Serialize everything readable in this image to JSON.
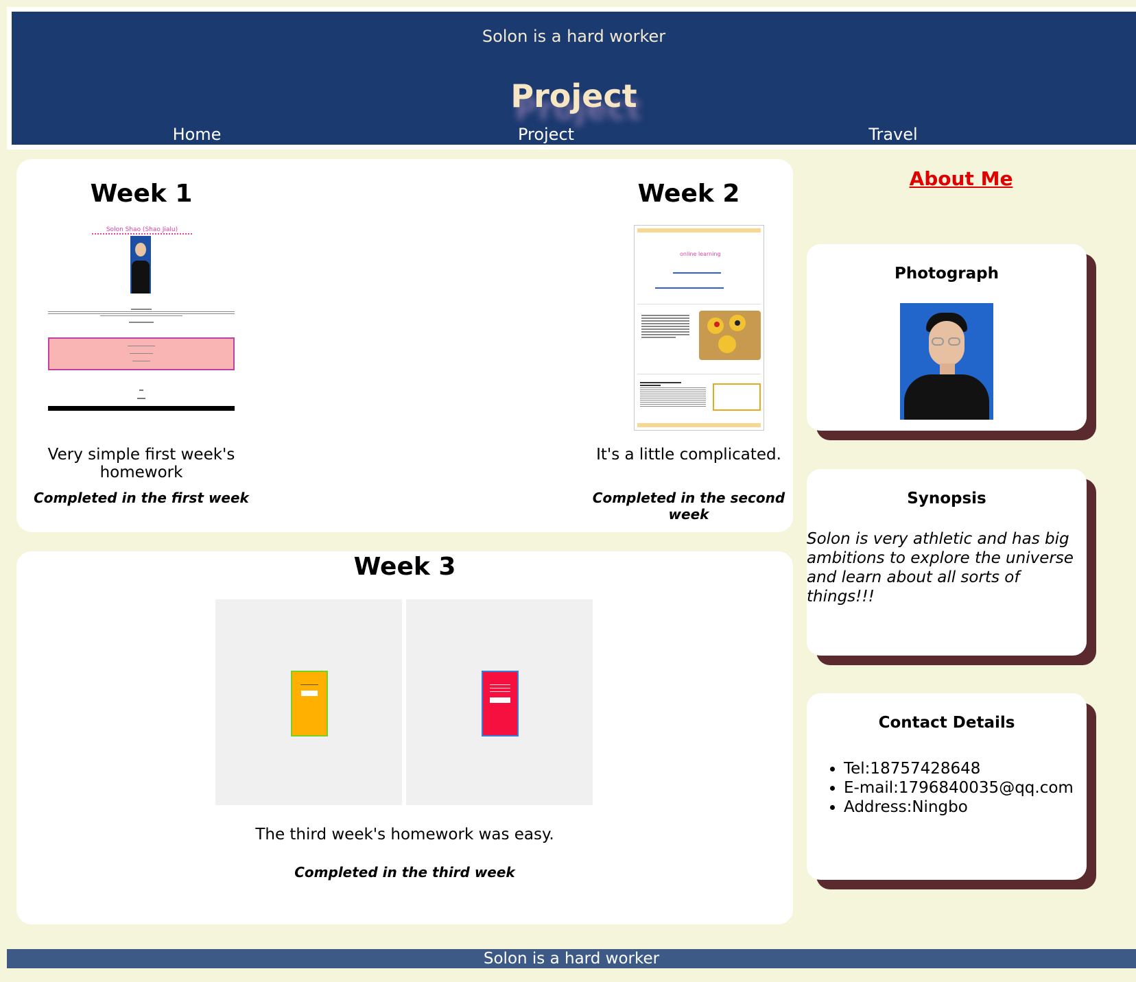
{
  "header": {
    "tagline": "Solon is a hard worker",
    "title": "Project",
    "nav": [
      "Home",
      "Project",
      "Travel"
    ]
  },
  "weeks": {
    "w1": {
      "title": "Week 1",
      "caption": "Very simple first week's homework",
      "completed": "Completed in the first week",
      "thumb_heading": "Solon Shao (Shao Jialu)"
    },
    "w2": {
      "title": "Week 2",
      "caption": "It's a little complicated.",
      "completed": "Completed in the second week",
      "thumb_logo": "online learning"
    },
    "w3": {
      "title": "Week 3",
      "caption": "The third week's homework was easy.",
      "completed": "Completed in the third week"
    }
  },
  "sidebar": {
    "about": "About Me",
    "photograph_title": "Photograph",
    "synopsis_title": "Synopsis",
    "synopsis_text": "Solon is very athletic and has big ambitions to explore the universe and learn about all sorts of things!!!",
    "contact_title": "Contact Details",
    "contacts": [
      "Tel:18757428648",
      "E-mail:1796840035@qq.com",
      "Address:Ningbo"
    ]
  },
  "footer": {
    "text": "Solon is a hard worker"
  },
  "colors": {
    "background": "#f5f5dc",
    "header": "#1b3a70",
    "footer": "#3c5a85",
    "card_shadow": "#5a2a2f",
    "about_link": "#e00000"
  }
}
